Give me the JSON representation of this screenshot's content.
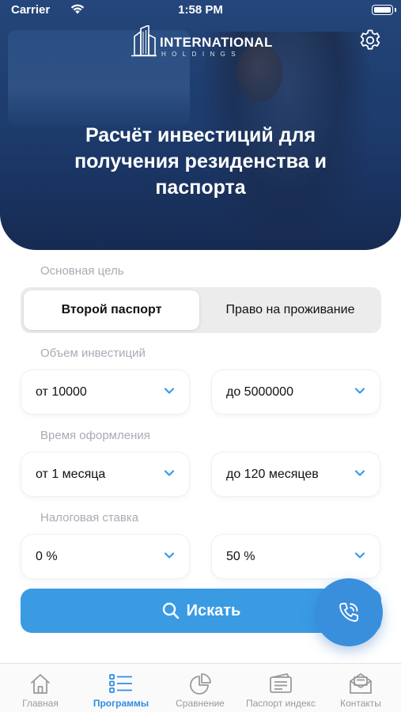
{
  "status_bar": {
    "carrier": "Carrier",
    "time": "1:58 PM"
  },
  "header": {
    "logo": {
      "brand": "INTERNATIONAL",
      "sub": "HOLDINGS"
    },
    "title": "Расчёт инвестиций для получения резиденства и паспорта",
    "settings_icon": "gear-icon"
  },
  "form": {
    "goal_label": "Основная цель",
    "goal_options": [
      "Второй паспорт",
      "Право на проживание"
    ],
    "goal_selected": "Второй паспорт",
    "investment_label": "Объем инвестиций",
    "investment_from": "от 10000",
    "investment_to": "до 5000000",
    "time_label": "Время оформления",
    "time_from": "от 1 месяца",
    "time_to": "до 120 месяцев",
    "tax_label": "Налоговая ставка",
    "tax_from": "0 %",
    "tax_to": "50 %",
    "search_label": "Искать"
  },
  "tabbar": {
    "items": [
      {
        "label": "Главная",
        "icon": "home-icon"
      },
      {
        "label": "Программы",
        "icon": "list-icon"
      },
      {
        "label": "Сравнение",
        "icon": "pie-chart-icon"
      },
      {
        "label": "Паспорт индекс",
        "icon": "passport-icon"
      },
      {
        "label": "Контакты",
        "icon": "mail-icon"
      }
    ],
    "active": "Программы"
  },
  "colors": {
    "accent": "#3a9be3",
    "fab": "#3a8fdc",
    "hero": "#223f70",
    "label": "#a7acb4"
  }
}
